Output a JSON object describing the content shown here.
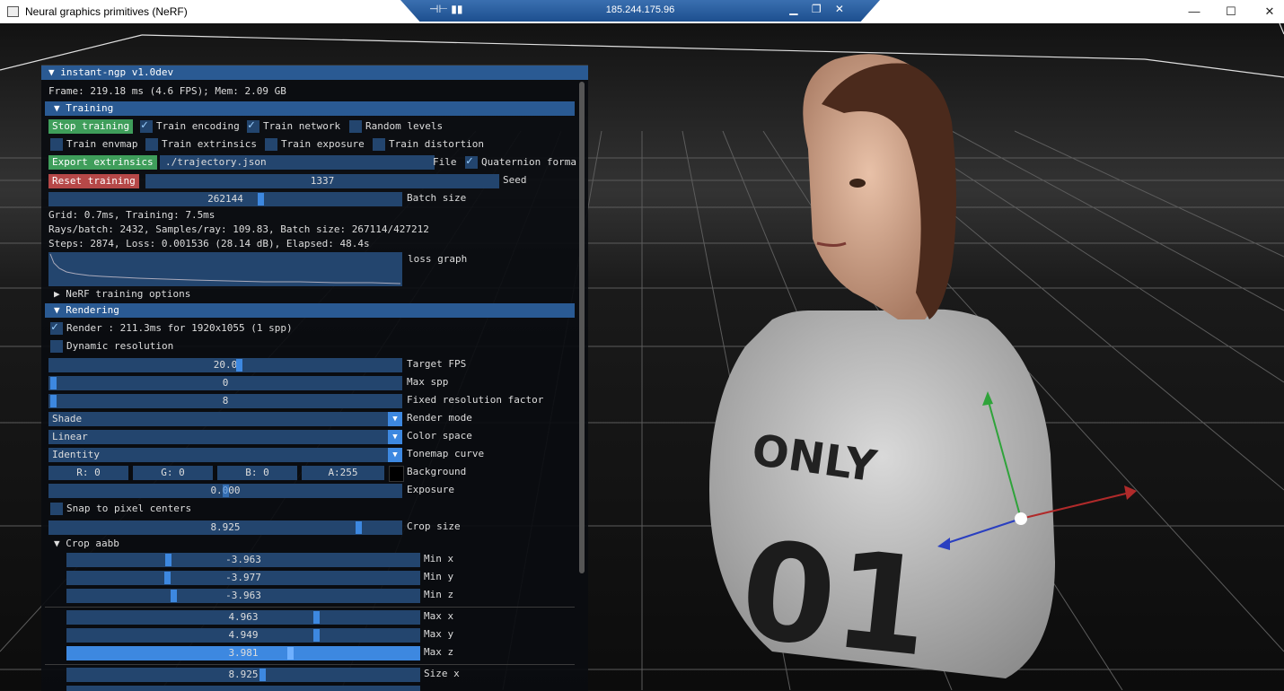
{
  "window": {
    "title": "Neural graphics primitives (NeRF)",
    "minimize": "—",
    "maximize": "☐",
    "close": "✕"
  },
  "remote_bar": {
    "ip": "185.244.175.96",
    "pin_icon": "pin-icon",
    "signal_icon": "signal-icon"
  },
  "panel": {
    "header": "▼ instant-ngp v1.0dev",
    "frame_info": "Frame: 219.18 ms (4.6 FPS); Mem: 2.09 GB",
    "training": {
      "section": "▼  Training",
      "stop_training": "Stop training",
      "train_encoding": "Train encoding",
      "train_network": "Train network",
      "random_levels": "Random levels",
      "train_envmap": "Train envmap",
      "train_extrinsics": "Train extrinsics",
      "train_exposure": "Train exposure",
      "train_distortion": "Train distortion",
      "export_extrinsics": "Export extrinsics",
      "trajectory_path": "./trajectory.json",
      "file_label": "File",
      "quaternion_format": "Quaternion forma",
      "reset_training": "Reset training",
      "seed_value": "1337",
      "seed_label": "Seed",
      "batch_size_value": "262144",
      "batch_size_label": "Batch size",
      "grid_info": "Grid: 0.7ms, Training: 7.5ms",
      "rays_info": "Rays/batch: 2432, Samples/ray: 109.83, Batch size: 267114/427212",
      "steps_info": "Steps: 2874, Loss: 0.001536 (28.14 dB), Elapsed: 48.4s",
      "loss_graph_label": "loss graph",
      "nerf_options": "▶ NeRF training options"
    },
    "rendering": {
      "section": "▼  Rendering",
      "render_info": "Render : 211.3ms for 1920x1055 (1 spp)",
      "dynamic_resolution": "Dynamic resolution",
      "target_fps_value": "20.0",
      "target_fps_label": "Target FPS",
      "max_spp_value": "0",
      "max_spp_label": "Max spp",
      "fixed_res_value": "8",
      "fixed_res_label": "Fixed resolution factor",
      "render_mode_value": "Shade",
      "render_mode_label": "Render mode",
      "color_space_value": "Linear",
      "color_space_label": "Color space",
      "tonemap_value": "Identity",
      "tonemap_label": "Tonemap curve",
      "bg_r": "R:  0",
      "bg_g": "G:  0",
      "bg_b": "B:  0",
      "bg_a": "A:255",
      "background_label": "Background",
      "exposure_value": "0.000",
      "exposure_label": "Exposure",
      "snap_pixel_centers": "Snap to pixel centers",
      "crop_size_value": "8.925",
      "crop_size_label": "Crop size",
      "crop_aabb": "▼ Crop aabb",
      "min_x_value": "-3.963",
      "min_x_label": "Min x",
      "min_y_value": "-3.977",
      "min_y_label": "Min y",
      "min_z_value": "-3.963",
      "min_z_label": "Min z",
      "max_x_value": "4.963",
      "max_x_label": "Max x",
      "max_y_value": "4.949",
      "max_y_label": "Max y",
      "max_z_value": "3.981",
      "max_z_label": "Max z",
      "size_x_value": "8.925",
      "size_x_label": "Size x"
    }
  },
  "colors": {
    "accent": "#2a5a93",
    "field": "#23456e",
    "grab": "#3d88e0",
    "green": "#3f9e5b",
    "red": "#b64848"
  }
}
